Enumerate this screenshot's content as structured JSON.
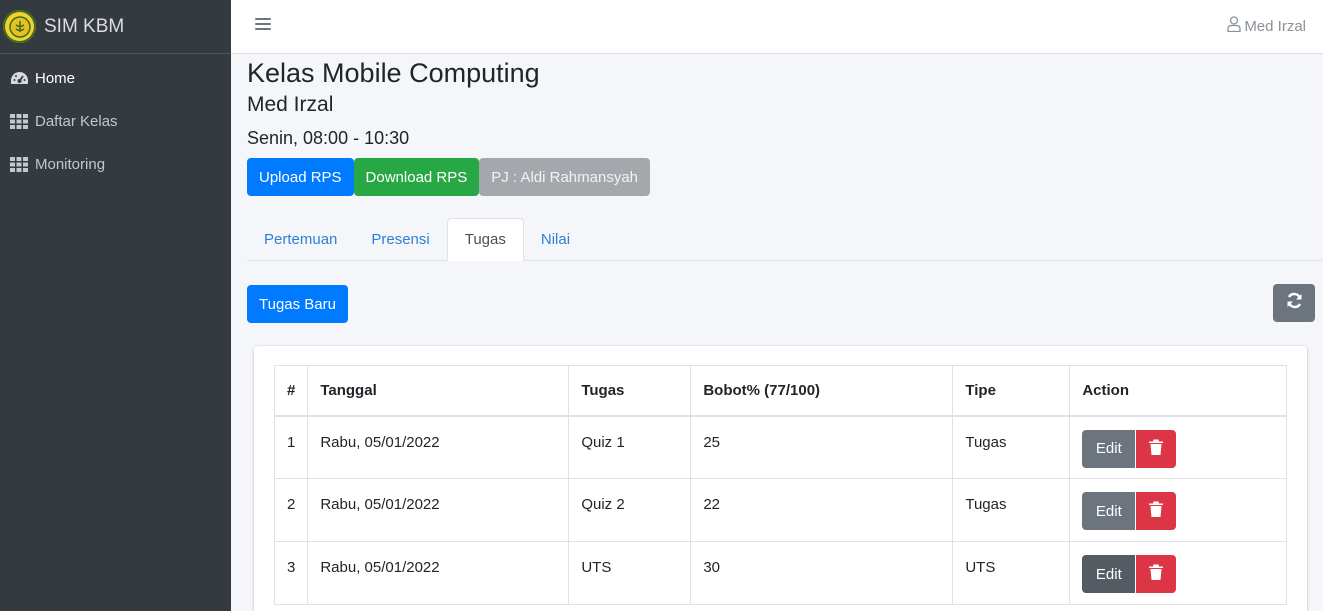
{
  "brand": {
    "name": "SIM KBM"
  },
  "sidebar": {
    "items": [
      {
        "label": "Home",
        "icon": "dashboard-icon"
      },
      {
        "label": "Daftar Kelas",
        "icon": "grid-icon"
      },
      {
        "label": "Monitoring",
        "icon": "grid-icon"
      }
    ]
  },
  "topbar": {
    "user_name": "Med Irzal"
  },
  "page": {
    "title": "Kelas Mobile Computing",
    "lecturer": "Med Irzal",
    "schedule": "Senin, 08:00 - 10:30"
  },
  "buttons": {
    "upload_rps": "Upload RPS",
    "download_rps": "Download RPS",
    "pj": "PJ : Aldi Rahmansyah",
    "new_task": "Tugas Baru"
  },
  "tabs": [
    {
      "label": "Pertemuan",
      "active": false
    },
    {
      "label": "Presensi",
      "active": false
    },
    {
      "label": "Tugas",
      "active": true
    },
    {
      "label": "Nilai",
      "active": false
    }
  ],
  "table": {
    "headers": [
      "#",
      "Tanggal",
      "Tugas",
      "Bobot% (77/100)",
      "Tipe",
      "Action"
    ],
    "edit_label": "Edit",
    "rows": [
      {
        "num": "1",
        "date": "Rabu, 05/01/2022",
        "task": "Quiz 1",
        "weight": "25",
        "type": "Tugas"
      },
      {
        "num": "2",
        "date": "Rabu, 05/01/2022",
        "task": "Quiz 2",
        "weight": "22",
        "type": "Tugas"
      },
      {
        "num": "3",
        "date": "Rabu, 05/01/2022",
        "task": "UTS",
        "weight": "30",
        "type": "UTS"
      }
    ]
  },
  "colors": {
    "sidebar_bg": "#343a40",
    "primary": "#007bff",
    "success": "#28a745",
    "secondary": "#6c757d",
    "danger": "#dc3545"
  }
}
